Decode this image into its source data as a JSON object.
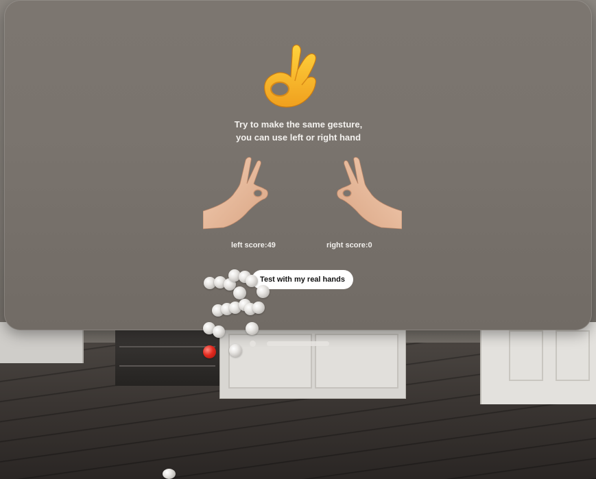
{
  "instruction": {
    "line1": "Try to make the same gesture,",
    "line2": "you can use left or right hand"
  },
  "icons": {
    "target_gesture": "ok-hand-emoji",
    "left_hand": "left-hand-ok-gesture",
    "right_hand": "right-hand-ok-gesture"
  },
  "scores": {
    "left": "left score:49",
    "right": "right score:0"
  },
  "actions": {
    "test_button": "Test with my real hands"
  },
  "colors": {
    "window": "#7a746e",
    "button_bg": "#ffffff",
    "text": "#f3f1ee",
    "emoji_yellow": "#f6b52a",
    "hand_skin": "#e8b99a",
    "joint_sphere": "#e9e7e4",
    "joint_sphere_active": "#e22a1f"
  }
}
